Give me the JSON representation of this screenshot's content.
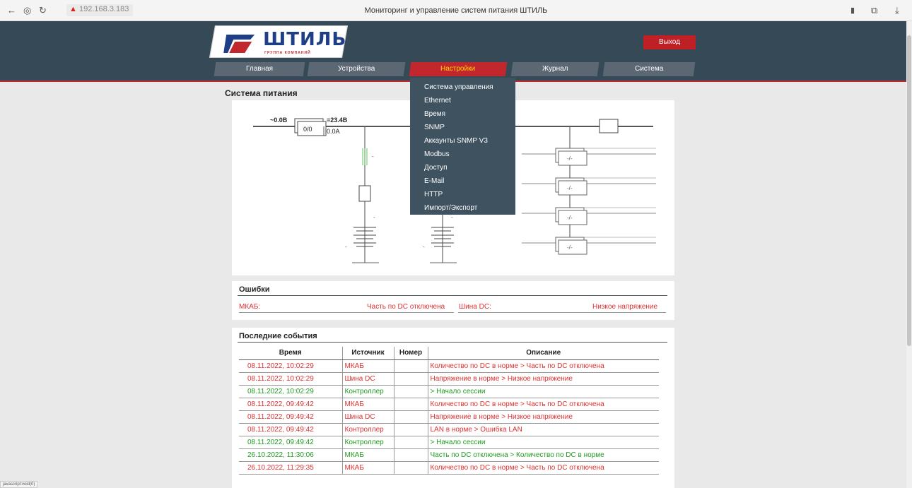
{
  "browser": {
    "url": "192.168.3.183",
    "title": "Мониторинг и управление систем питания ШТИЛЬ"
  },
  "header": {
    "logo_text": "ШТИЛЬ",
    "logo_sub": "ГРУППА КОМПАНИЙ",
    "logout_label": "Выход",
    "nav": [
      {
        "label": "Главная"
      },
      {
        "label": "Устройства"
      },
      {
        "label": "Настройки",
        "active": true
      },
      {
        "label": "Журнал"
      },
      {
        "label": "Система"
      }
    ]
  },
  "settings_menu": [
    "Система управления",
    "Ethernet",
    "Время",
    "SNMP",
    "Аккаунты SNMP V3",
    "Modbus",
    "Доступ",
    "E-Mail",
    "HTTP",
    "Импорт/Экспорт"
  ],
  "power_system": {
    "title": "Система питания",
    "ac_voltage": "~0.0В",
    "rectifier_count": "0/0",
    "dc_voltage": "=23.4В",
    "dc_current": "0.0А",
    "breaker_label": "-/-",
    "dash": "-"
  },
  "errors": {
    "title": "Ошибки",
    "items": [
      {
        "source": "МКАБ:",
        "message": "Часть по DC отключена"
      },
      {
        "source": "Шина DC:",
        "message": "Низкое напряжение"
      }
    ]
  },
  "events": {
    "title": "Последние события",
    "columns": [
      "Время",
      "Источник",
      "Номер",
      "Описание"
    ],
    "rows": [
      {
        "time": "08.11.2022, 10:02:29",
        "source": "МКАБ",
        "number": "",
        "description": "Количество по DC в норме > Часть по DC отключена",
        "color": "red"
      },
      {
        "time": "08.11.2022, 10:02:29",
        "source": "Шина DC",
        "number": "",
        "description": "Напряжение в норме > Низкое напряжение",
        "color": "red"
      },
      {
        "time": "08.11.2022, 10:02:29",
        "source": "Контроллер",
        "number": "",
        "description": "> Начало сессии",
        "color": "green"
      },
      {
        "time": "08.11.2022, 09:49:42",
        "source": "МКАБ",
        "number": "",
        "description": "Количество по DC в норме > Часть по DC отключена",
        "color": "red"
      },
      {
        "time": "08.11.2022, 09:49:42",
        "source": "Шина DC",
        "number": "",
        "description": "Напряжение в норме > Низкое напряжение",
        "color": "red"
      },
      {
        "time": "08.11.2022, 09:49:42",
        "source": "Контроллер",
        "number": "",
        "description": "LAN в норме > Ошибка LAN",
        "color": "red"
      },
      {
        "time": "08.11.2022, 09:49:42",
        "source": "Контроллер",
        "number": "",
        "description": "> Начало сессии",
        "color": "green"
      },
      {
        "time": "26.10.2022, 11:30:06",
        "source": "МКАБ",
        "number": "",
        "description": "Часть по DC отключена > Количество по DC в норме",
        "color": "green"
      },
      {
        "time": "26.10.2022, 11:29:35",
        "source": "МКАБ",
        "number": "",
        "description": "Количество по DC в норме > Часть по DC отключена",
        "color": "red"
      }
    ]
  },
  "status_bar": "javascript:void(0)",
  "colors": {
    "header_bg": "#364957",
    "accent_red": "#c1272d",
    "nav_tab": "#5b6873",
    "menu_bg": "#3f5260",
    "error_text": "#e03030",
    "ok_text": "#1f9b1f"
  }
}
